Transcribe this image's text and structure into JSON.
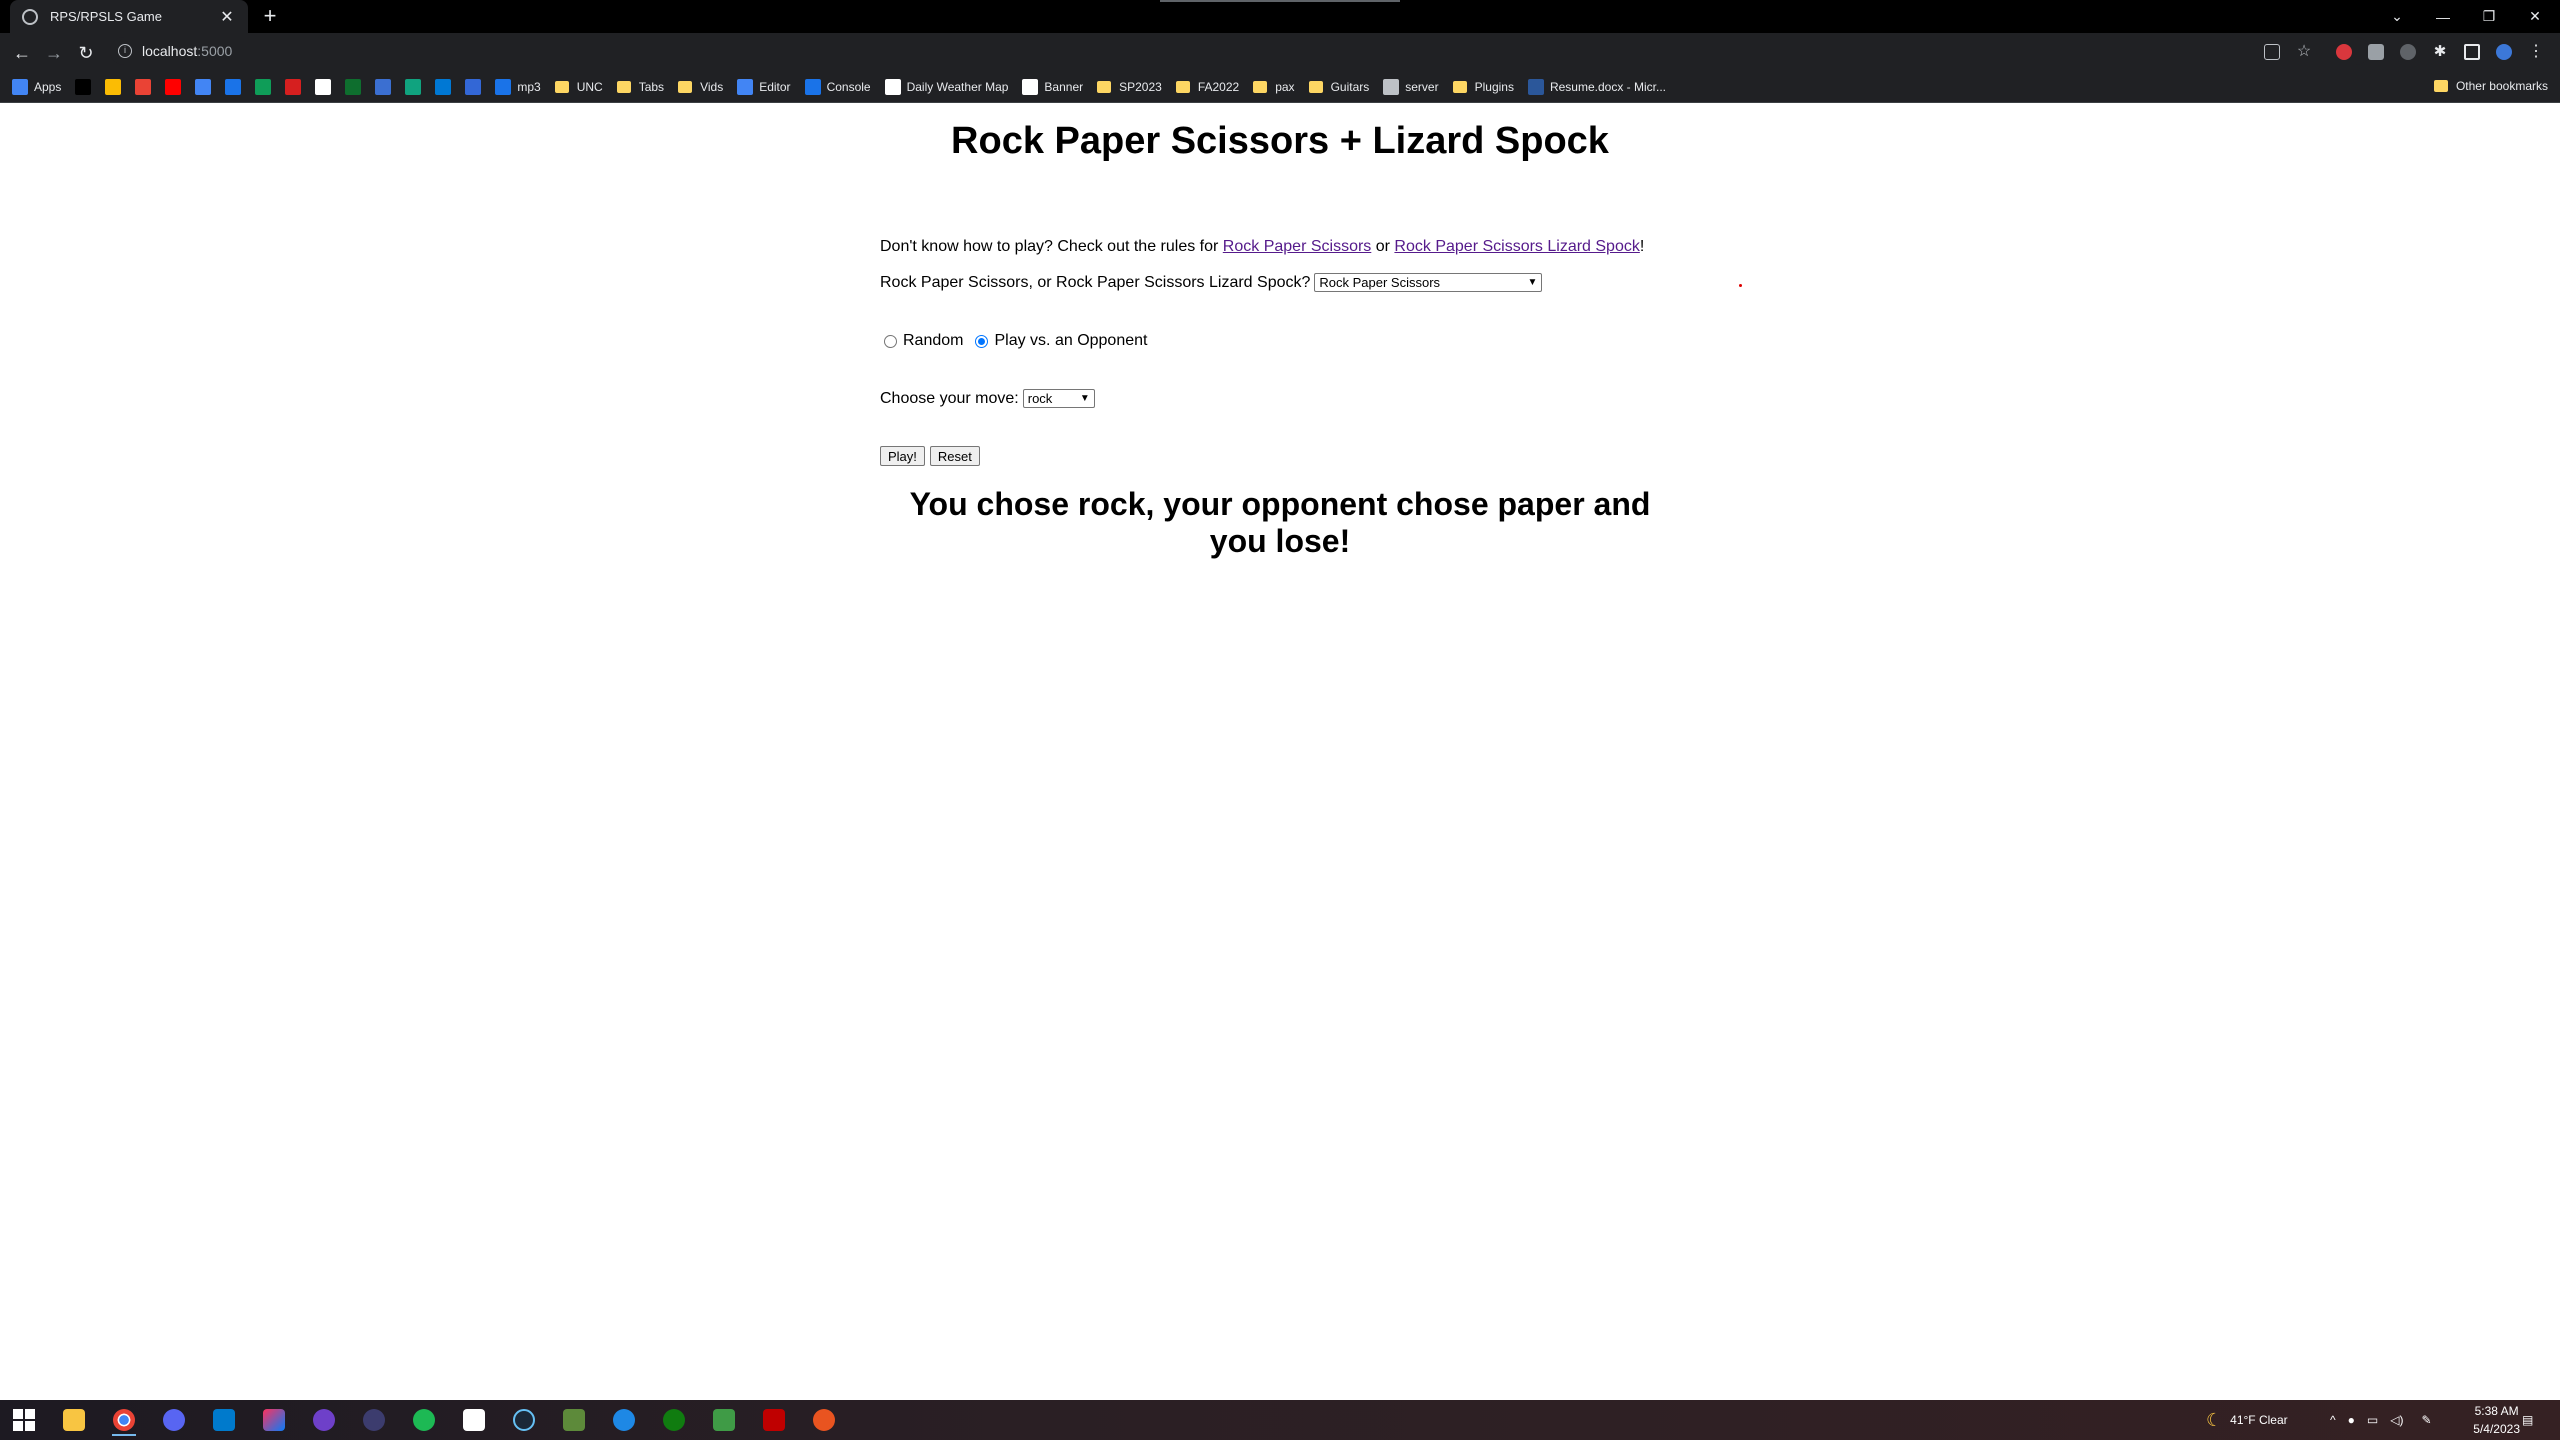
{
  "browser": {
    "tab_title": "RPS/RPSLS Game",
    "tab_close_label": "✕",
    "new_tab_label": "+",
    "url": "localhost",
    "url_port": ":5000",
    "bookmarks": [
      {
        "label": "Apps",
        "icon": "apps-grid-icon",
        "color": "#4285f4"
      },
      {
        "label": "",
        "icon": "black-square-icon",
        "color": "#000000"
      },
      {
        "label": "",
        "icon": "google-drive-icon",
        "color": "#fbbc04"
      },
      {
        "label": "",
        "icon": "gmail-icon",
        "color": "#ea4335"
      },
      {
        "label": "",
        "icon": "youtube-icon",
        "color": "#ff0000"
      },
      {
        "label": "",
        "icon": "google-docs-icon",
        "color": "#4285f4"
      },
      {
        "label": "",
        "icon": "pen-icon",
        "color": "#1a73e8"
      },
      {
        "label": "",
        "icon": "google-sheets-icon",
        "color": "#0f9d58"
      },
      {
        "label": "",
        "icon": "wf-icon",
        "color": "#d61f1f"
      },
      {
        "label": "",
        "icon": "amazon-icon",
        "color": "#ffffff"
      },
      {
        "label": "",
        "icon": "h-icon",
        "color": "#0e6e2e"
      },
      {
        "label": "",
        "icon": "pt-icon",
        "color": "#3b6fd1"
      },
      {
        "label": "",
        "icon": "chatgpt-icon",
        "color": "#10a37f"
      },
      {
        "label": "",
        "icon": "outlook-icon",
        "color": "#0078d4"
      },
      {
        "label": "",
        "icon": "bars-icon",
        "color": "#3367d6"
      },
      {
        "label": "mp3",
        "icon": "mp3-icon",
        "color": "#1a73e8"
      },
      {
        "label": "UNC",
        "icon": "folder-icon",
        "folder": true
      },
      {
        "label": "Tabs",
        "icon": "folder-icon",
        "folder": true
      },
      {
        "label": "Vids",
        "icon": "folder-icon",
        "folder": true
      },
      {
        "label": "Editor",
        "icon": "editor-icon",
        "color": "#4285f4"
      },
      {
        "label": "Console",
        "icon": "console-icon",
        "color": "#1a73e8"
      },
      {
        "label": "Daily Weather Map",
        "icon": "weather-icon",
        "color": "#ffffff"
      },
      {
        "label": "Banner",
        "icon": "banner-icon",
        "color": "#ffffff"
      },
      {
        "label": "SP2023",
        "icon": "folder-icon",
        "folder": true
      },
      {
        "label": "FA2022",
        "icon": "folder-icon",
        "folder": true
      },
      {
        "label": "pax",
        "icon": "folder-icon",
        "folder": true
      },
      {
        "label": "Guitars",
        "icon": "folder-icon",
        "folder": true
      },
      {
        "label": "server",
        "icon": "globe-icon",
        "color": "#bdc1c6"
      },
      {
        "label": "Plugins",
        "icon": "folder-icon",
        "folder": true
      },
      {
        "label": "Resume.docx - Micr...",
        "icon": "word-icon",
        "color": "#2b579a"
      }
    ],
    "other_bookmarks": "Other bookmarks"
  },
  "page": {
    "title": "Rock Paper Scissors + Lizard Spock",
    "rules_prefix": "Don't know how to play? Check out the rules for ",
    "rules_link_rps": "Rock Paper Scissors",
    "rules_middle": " or ",
    "rules_link_rpsls": "Rock Paper Scissors Lizard Spock",
    "rules_suffix": "!",
    "mode_question": "Rock Paper Scissors, or Rock Paper Scissors Lizard Spock?",
    "mode_selected": "Rock Paper Scissors",
    "radio_random": "Random",
    "radio_opponent": "Play vs. an Opponent",
    "radio_checked": "opponent",
    "move_label": "Choose your move:",
    "move_selected": "rock",
    "play_button": "Play!",
    "reset_button": "Reset",
    "result": "You chose rock, your opponent chose paper and you lose!"
  },
  "taskbar": {
    "weather": "41°F  Clear",
    "time": "5:38 AM",
    "date": "5/4/2023"
  }
}
